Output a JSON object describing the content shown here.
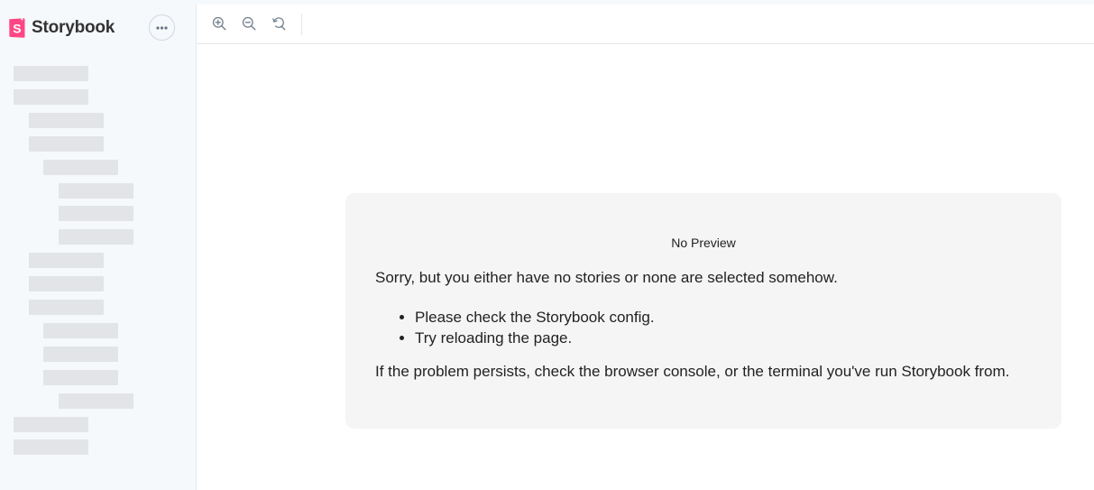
{
  "sidebar": {
    "brand": {
      "name": "Storybook",
      "logo_letter": "S",
      "logo_color": "#FF4785"
    },
    "menu_icon": "ellipsis-icon",
    "skeleton_color": "#E2E4E7",
    "skeleton_depths": [
      0,
      0,
      1,
      1,
      2,
      3,
      3,
      3,
      1,
      1,
      1,
      2,
      2,
      2,
      3,
      0,
      0
    ]
  },
  "toolbar": {
    "tools": [
      {
        "icon": "zoom-in-icon"
      },
      {
        "icon": "zoom-out-icon"
      },
      {
        "icon": "reset-zoom-icon"
      }
    ]
  },
  "preview": {
    "title": "No Preview",
    "intro": "Sorry, but you either have no stories or none are selected somehow.",
    "bullets": [
      "Please check the Storybook config.",
      "Try reloading the page."
    ],
    "outro": "If the problem persists, check the browser console, or the terminal you've run Storybook from."
  }
}
